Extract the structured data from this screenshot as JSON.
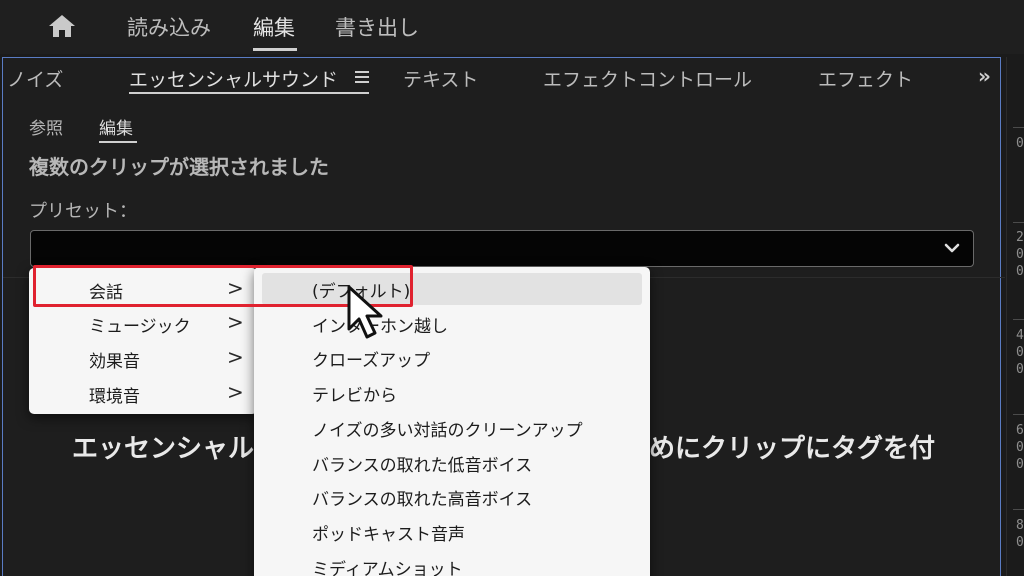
{
  "workspace": {
    "tabs": [
      {
        "label": "読み込み"
      },
      {
        "label": "編集"
      },
      {
        "label": "書き出し"
      }
    ],
    "active": "編集"
  },
  "panel": {
    "tabs": [
      {
        "label": "ノイズ"
      },
      {
        "label": "エッセンシャルサウンド"
      },
      {
        "label": "テキスト"
      },
      {
        "label": "エフェクトコントロール"
      },
      {
        "label": "エフェクト"
      }
    ],
    "overflow_label": "»",
    "sub_tabs": [
      {
        "label": "参照"
      },
      {
        "label": "編集"
      }
    ],
    "status_text": "複数のクリップが選択されました",
    "preset_label": "プリセット：",
    "preset_value": "",
    "hint_text_left": "エッセンシャル",
    "hint_text_right": "めにクリップにタグを付"
  },
  "ruler": {
    "labels": [
      "0",
      "2",
      "0",
      "0",
      "4",
      "0",
      "0",
      "6",
      "0",
      "0",
      "8",
      "0"
    ]
  },
  "menu_categories": {
    "items": [
      {
        "label": "会話",
        "arrow": ">"
      },
      {
        "label": "ミュージック",
        "arrow": ">"
      },
      {
        "label": "効果音",
        "arrow": ">"
      },
      {
        "label": "環境音",
        "arrow": ">"
      }
    ],
    "highlighted": "会話"
  },
  "menu_presets": {
    "items": [
      {
        "label": "(デフォルト)"
      },
      {
        "label": "インターホン越し"
      },
      {
        "label": "クローズアップ"
      },
      {
        "label": "テレビから"
      },
      {
        "label": "ノイズの多い対話のクリーンアップ"
      },
      {
        "label": "バランスの取れた低音ボイス"
      },
      {
        "label": "バランスの取れた高音ボイス"
      },
      {
        "label": "ポッドキャスト音声"
      },
      {
        "label": "ミディアムショット"
      }
    ],
    "hovered": "(デフォルト)"
  },
  "colors": {
    "accent_border": "#5a7cc4",
    "highlight_red": "#e0222f",
    "menu_bg": "#f6f6f6"
  }
}
